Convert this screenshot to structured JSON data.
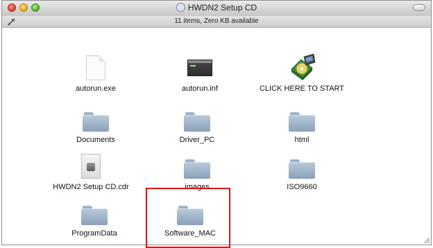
{
  "window": {
    "title": "HWDN2 Setup CD",
    "status": "11 items, Zero KB available"
  },
  "items": [
    {
      "label": "autorun.exe",
      "icon": "document-icon"
    },
    {
      "label": "autorun.inf",
      "icon": "terminal-file-icon"
    },
    {
      "label": "CLICK HERE TO START",
      "icon": "installer-disc-icon"
    },
    {
      "label": "Documents",
      "icon": "folder-icon"
    },
    {
      "label": "Driver_PC",
      "icon": "folder-icon"
    },
    {
      "label": "html",
      "icon": "folder-icon"
    },
    {
      "label": "HWDN2 Setup CD.cdr",
      "icon": "disk-image-icon"
    },
    {
      "label": "images",
      "icon": "folder-icon"
    },
    {
      "label": "ISO9660",
      "icon": "folder-icon"
    },
    {
      "label": "ProgramData",
      "icon": "folder-icon"
    },
    {
      "label": "Software_MAC",
      "icon": "folder-icon"
    }
  ],
  "colors": {
    "highlight": "#e31313",
    "folder": "#a7bace"
  }
}
